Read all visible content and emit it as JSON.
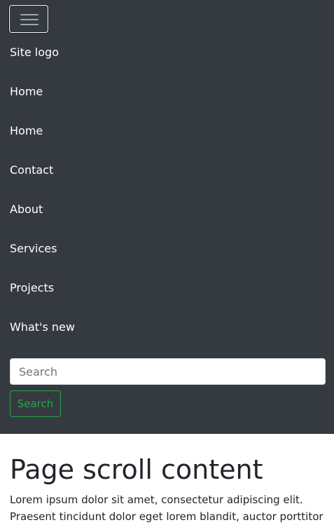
{
  "navbar": {
    "toggle_icon": "hamburger-menu-icon",
    "brand": "Site logo",
    "items": [
      {
        "label": "Home"
      },
      {
        "label": "Home"
      },
      {
        "label": "Contact"
      },
      {
        "label": "About"
      },
      {
        "label": "Services"
      },
      {
        "label": "Projects"
      },
      {
        "label": "What's new"
      }
    ],
    "search": {
      "placeholder": "Search",
      "button_label": "Search"
    },
    "colors": {
      "background": "#343a40",
      "search_button": "#28a745"
    }
  },
  "main": {
    "heading": "Page scroll content",
    "paragraph": "Lorem ipsum dolor sit amet, consectetur adipiscing elit. Praesent tincidunt dolor eget lorem blandit, auctor porttitor"
  }
}
